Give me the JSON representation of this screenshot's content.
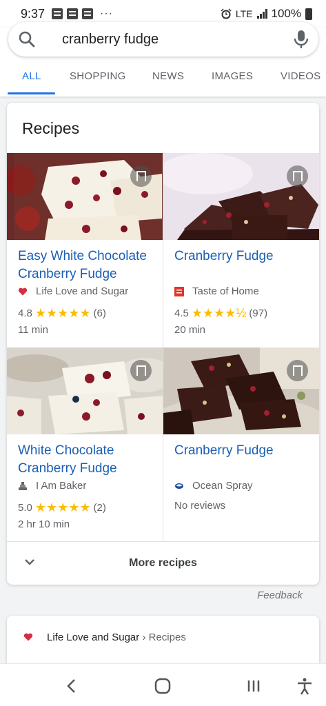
{
  "status_bar": {
    "time": "9:37",
    "dots": "···",
    "network": "LTE",
    "battery": "100%"
  },
  "search": {
    "query": "cranberry fudge"
  },
  "tabs": [
    {
      "label": "ALL",
      "active": true
    },
    {
      "label": "SHOPPING",
      "active": false
    },
    {
      "label": "NEWS",
      "active": false
    },
    {
      "label": "IMAGES",
      "active": false
    },
    {
      "label": "VIDEOS",
      "active": false
    }
  ],
  "recipes_card": {
    "title": "Recipes",
    "items": [
      {
        "title": "Easy White Chocolate Cranberry Fudge",
        "source": "Life Love and Sugar",
        "source_icon": "heart-icon",
        "rating": "4.8",
        "stars": "★★★★★",
        "reviews": "(6)",
        "time": "11 min"
      },
      {
        "title": "Cranberry Fudge",
        "source": "Taste of Home",
        "source_icon": "taste-of-home-logo",
        "rating": "4.5",
        "stars": "★★★★½",
        "reviews": "(97)",
        "time": "20 min"
      },
      {
        "title": "White Chocolate Cranberry Fudge",
        "source": "I Am Baker",
        "source_icon": "cake-icon",
        "rating": "5.0",
        "stars": "★★★★★",
        "reviews": "(2)",
        "time": "2 hr 10 min"
      },
      {
        "title": "Cranberry Fudge",
        "source": "Ocean Spray",
        "source_icon": "ocean-spray-logo",
        "no_reviews": "No reviews"
      }
    ],
    "more_label": "More recipes"
  },
  "feedback": "Feedback",
  "next_result": {
    "site": "Life Love and Sugar",
    "separator": " › ",
    "path": "Recipes"
  },
  "colors": {
    "link": "#1a5fb4",
    "accent": "#1a73e8",
    "star": "#fbbc04"
  }
}
